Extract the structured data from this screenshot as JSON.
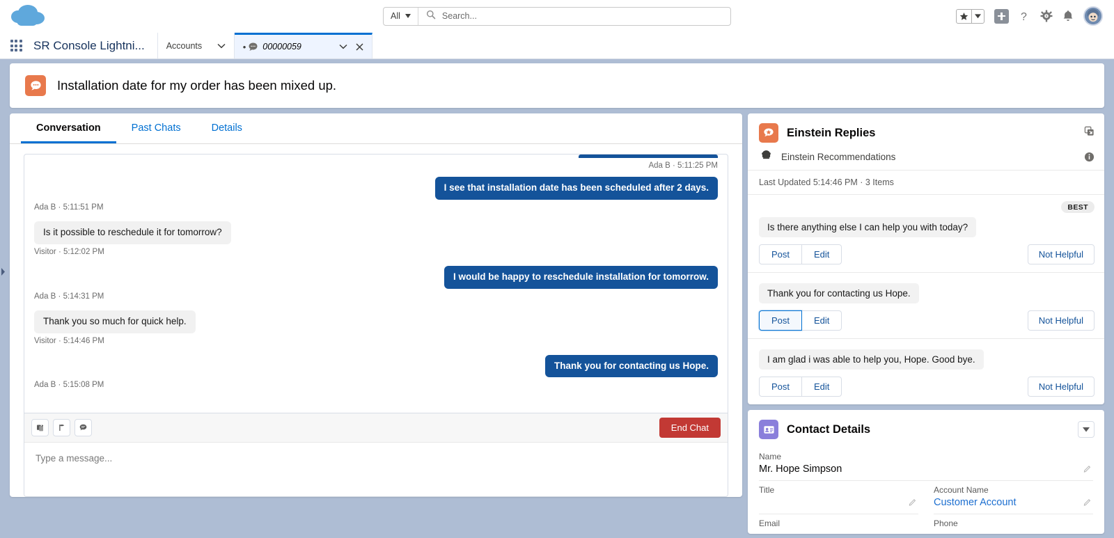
{
  "global_header": {
    "logo": "salesforce-cloud-logo",
    "search": {
      "scope": "All",
      "placeholder": "Search...",
      "value": ""
    },
    "actions": [
      {
        "name": "favorites",
        "icon": "star-icon"
      },
      {
        "name": "favorites-dropdown",
        "icon": "chevron-down-icon"
      },
      {
        "name": "global-add",
        "icon": "plus-icon"
      },
      {
        "name": "help",
        "icon": "question-mark-icon"
      },
      {
        "name": "setup",
        "icon": "gear-icon"
      },
      {
        "name": "notifications",
        "icon": "bell-icon"
      },
      {
        "name": "user-profile",
        "icon": "avatar"
      }
    ]
  },
  "console_tabs": {
    "app_name": "SR Console Lightni...",
    "tabs": [
      {
        "label": "Accounts",
        "active": false,
        "icon": "",
        "dirty": false
      },
      {
        "label": "00000059",
        "active": true,
        "icon": "chat-icon",
        "dirty": true
      }
    ]
  },
  "highlights": {
    "icon": "live-chat-icon",
    "title": "Installation date for my order has been mixed up."
  },
  "conversation": {
    "tabs": [
      {
        "label": "Conversation",
        "active": true
      },
      {
        "label": "Past Chats",
        "active": false
      },
      {
        "label": "Details",
        "active": false
      }
    ],
    "messages": [
      {
        "sender": "Ada B",
        "time": "5:11:25 PM",
        "side": "agent",
        "text": "",
        "clipped": true
      },
      {
        "sender": "Ada B",
        "time": "5:11:51 PM",
        "side": "agent",
        "text": "I see that installation date has been scheduled after 2 days."
      },
      {
        "sender": "Visitor",
        "time": "5:12:02 PM",
        "side": "visitor",
        "text": "Is it possible to reschedule it for tomorrow?"
      },
      {
        "sender": "Ada B",
        "time": "5:14:31 PM",
        "side": "agent",
        "text": "I would be happy to reschedule installation for tomorrow."
      },
      {
        "sender": "Visitor",
        "time": "5:14:46 PM",
        "side": "visitor",
        "text": "Thank you so much for quick help."
      },
      {
        "sender": "Ada B",
        "time": "5:15:08 PM",
        "side": "agent",
        "text": "Thank you for contacting us Hope."
      }
    ],
    "composer": {
      "tools": [
        {
          "name": "transfer-chat-icon"
        },
        {
          "name": "raise-flag-icon"
        },
        {
          "name": "quick-text-icon"
        }
      ],
      "end_chat_label": "End Chat",
      "placeholder": "Type a message..."
    }
  },
  "einstein": {
    "title": "Einstein Replies",
    "icon": "einstein-replies-icon",
    "expand_icon": "pop-out-icon",
    "info_icon": "info-icon",
    "subheader": {
      "icon": "einstein-icon",
      "label": "Einstein Recommendations"
    },
    "last_updated": "Last Updated 5:14:46 PM · 3 Items",
    "best_badge": "BEST",
    "recommendations": [
      {
        "text": "Is there anything else I can help you with today?",
        "best": true,
        "post_label": "Post",
        "edit_label": "Edit",
        "not_helpful_label": "Not Helpful",
        "post_focused": false
      },
      {
        "text": "Thank you for contacting us Hope.",
        "best": false,
        "post_label": "Post",
        "edit_label": "Edit",
        "not_helpful_label": "Not Helpful",
        "post_focused": true
      },
      {
        "text": "I am glad i was able to help you, Hope. Good bye.",
        "best": false,
        "post_label": "Post",
        "edit_label": "Edit",
        "not_helpful_label": "Not Helpful",
        "post_focused": false
      }
    ]
  },
  "contact_details": {
    "title": "Contact Details",
    "icon": "contact-card-icon",
    "collapse_icon": "caret-down-icon",
    "fields": {
      "name_label": "Name",
      "name_value": "Mr. Hope Simpson",
      "title_label": "Title",
      "title_value": "",
      "account_label": "Account Name",
      "account_value": "Customer Account",
      "email_label": "Email",
      "phone_label": "Phone"
    }
  },
  "colors": {
    "brand_blue": "#0070d2",
    "agent_bubble": "#14539a",
    "einstein_orange": "#e8794c",
    "contact_purple": "#8a7fdb",
    "end_chat_red": "#c23934",
    "console_bg": "#aebdd4"
  }
}
